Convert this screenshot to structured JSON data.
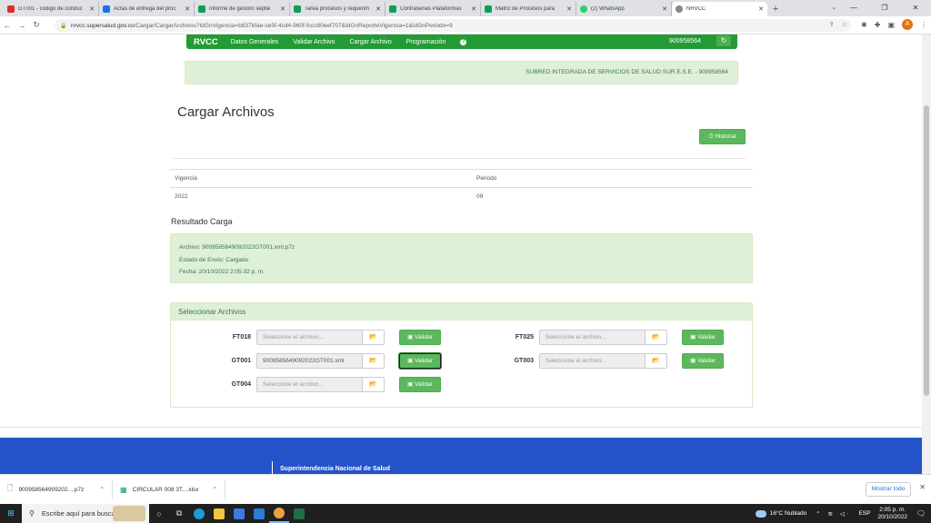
{
  "browser": {
    "tabs": [
      {
        "label": "GT001 - codigo de conduc",
        "icon": "gmail-icon",
        "color": "#d93025"
      },
      {
        "label": "Actas de entrega del proc",
        "icon": "drive-icon",
        "color": "#1a73e8"
      },
      {
        "label": "Informe de gestión septie",
        "icon": "sheets-icon",
        "color": "#0f9d58"
      },
      {
        "label": "Tarea procesos y requerim",
        "icon": "sheets-icon",
        "color": "#0f9d58"
      },
      {
        "label": "Contraseñas Plataformas",
        "icon": "sheets-icon",
        "color": "#0f9d58"
      },
      {
        "label": "Matriz de Procesos para",
        "icon": "sheets-icon",
        "color": "#0f9d58"
      },
      {
        "label": "(2) WhatsApp",
        "icon": "whatsapp-icon",
        "color": "#25d366"
      },
      {
        "label": "NRVCC",
        "icon": "globe-icon",
        "color": "#888888"
      }
    ],
    "url_host": "nrvcc.supersalud.gov.co",
    "url_path": "/Cargar/CargarArchivos?IdGnVigencia=b837bfae-ce5f-4cd4-960f-fccc80eef707&IdGnReporteVigencia=1&IdGnPeriodo=9",
    "profile_initial": "A"
  },
  "app": {
    "brand": "RVCC",
    "nav": [
      "Datos Generales",
      "Validar Archivo",
      "Cargar Archivo",
      "Programación"
    ],
    "nit": "900958564",
    "entity": "SUBRED INTEGRADA DE SERVICIOS DE SALUD SUR E.S.E. - 900958564",
    "page_title": "Cargar Archivos",
    "history_label": "Historial",
    "vigencia_header": "Vigencia",
    "periodo_header": "Periodo",
    "vigencia": "2022",
    "periodo": "09",
    "result_title": "Resultado Carga",
    "result_file": "Archivo: 9009585649092022GT001.xml.p7z",
    "result_status": "Estado de Envío: Cargado",
    "result_date": "Fecha: 20/10/2022 2:05:32 p. m.",
    "panel_title": "Seleccionar Archivos",
    "placeholder": "Seleccione el archivo...",
    "validate_label": "Validar",
    "files": [
      {
        "code": "FT018",
        "value": ""
      },
      {
        "code": "FT025",
        "value": ""
      },
      {
        "code": "GT001",
        "value": "9009585649092022GT001.xml"
      },
      {
        "code": "GT003",
        "value": ""
      },
      {
        "code": "GT004",
        "value": ""
      }
    ],
    "footer_text": "Superintendencia Nacional de Salud"
  },
  "downloads": {
    "items": [
      "900958564909202....p7z",
      "CIRCULAR 008 3T....xlsx"
    ],
    "show_all": "Mostrar todo"
  },
  "taskbar": {
    "search_placeholder": "Escribe aquí para buscar",
    "weather": "16°C  Nublado",
    "lang": "ESP",
    "time": "2:05 p. m.",
    "date": "20/10/2022"
  }
}
